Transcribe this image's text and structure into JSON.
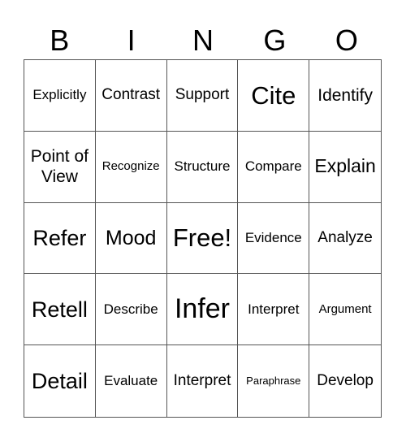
{
  "header": [
    "B",
    "I",
    "N",
    "G",
    "O"
  ],
  "cells": [
    "Explicitly",
    "Contrast",
    "Support",
    "Cite",
    "Identify",
    "Point of View",
    "Recognize",
    "Structure",
    "Compare",
    "Explain",
    "Refer",
    "Mood",
    "Free!",
    "Evidence",
    "Analyze",
    "Retell",
    "Describe",
    "Infer",
    "Interpret",
    "Argument",
    "Detail",
    "Evaluate",
    "Interpret",
    "Paraphrase",
    "Develop"
  ]
}
